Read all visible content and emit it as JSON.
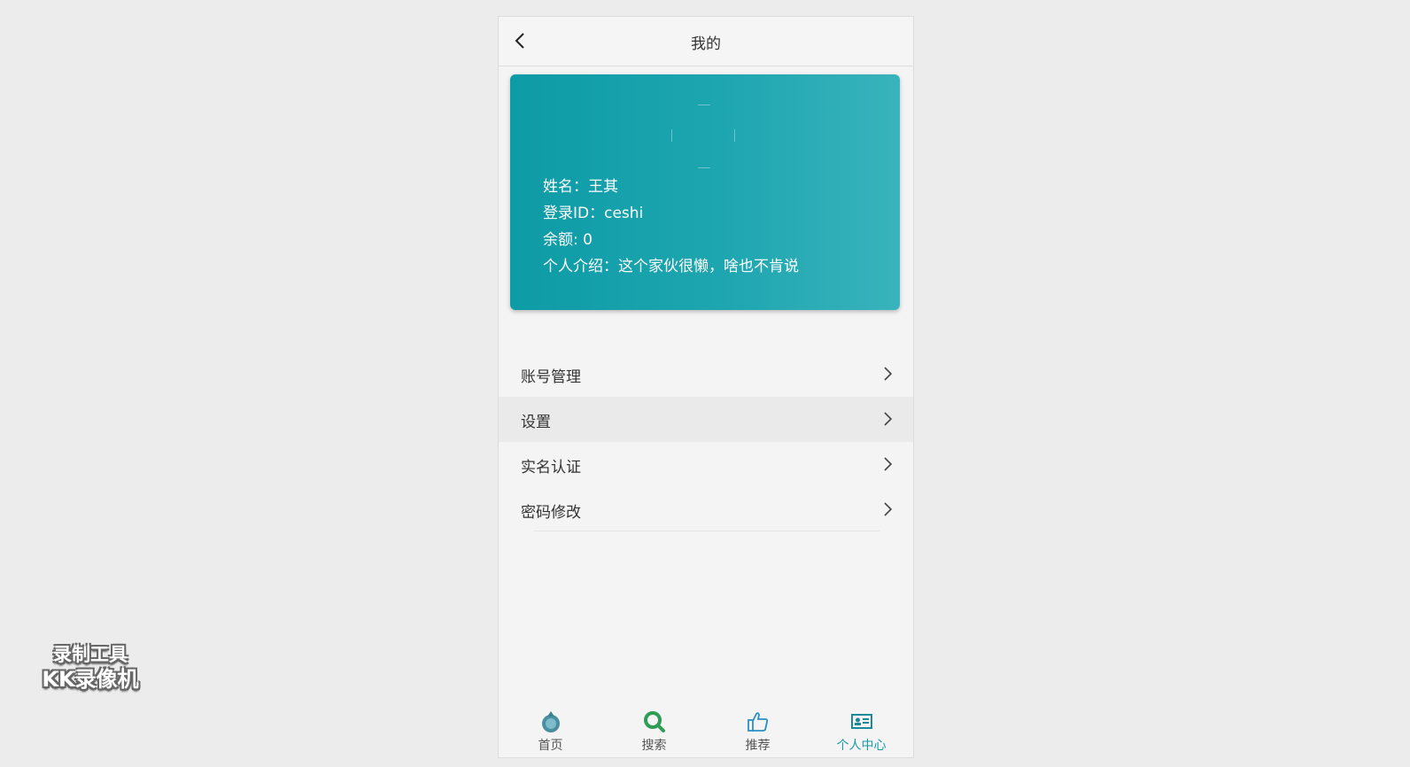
{
  "header": {
    "title": "我的"
  },
  "profile": {
    "name_line": "姓名：王其",
    "login_line": "登录ID：ceshi",
    "balance_line": "余额: 0",
    "intro_line": "个人介绍：这个家伙很懒，啥也不肯说"
  },
  "menu": {
    "items": [
      {
        "label": "账号管理"
      },
      {
        "label": "设置"
      },
      {
        "label": "实名认证"
      },
      {
        "label": "密码修改"
      }
    ]
  },
  "tabbar": {
    "tabs": [
      {
        "label": "首页",
        "icon": "home-icon"
      },
      {
        "label": "搜索",
        "icon": "search-icon"
      },
      {
        "label": "推荐",
        "icon": "thumbs-up-icon"
      },
      {
        "label": "个人中心",
        "icon": "id-card-icon"
      }
    ],
    "active_color": "#1a9aa5"
  },
  "watermark": {
    "line1": "录制工具",
    "line2": "KK录像机"
  },
  "colors": {
    "card_start": "#0d9ba6",
    "card_end": "#39b3bc",
    "background": "#ececec"
  }
}
